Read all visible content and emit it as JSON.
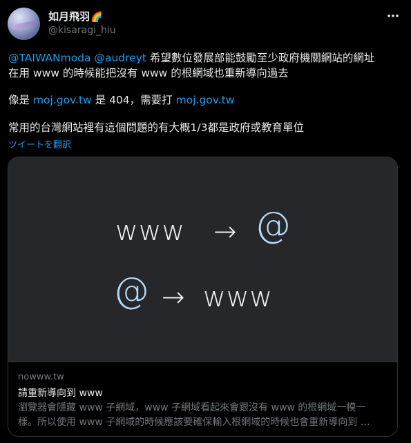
{
  "author": {
    "display_name": "如月飛羽",
    "emoji": "🌈",
    "handle": "@kisaragi_hiu"
  },
  "tweet": {
    "line1": {
      "mention1": "@TAIWANmoda",
      "mention2": "@audreyt",
      "text": " 希望數位發展部能鼓勵至少政府機關網站的網址"
    },
    "line2": "在用 www 的時候能把沒有 www 的根網域也重新導向過去",
    "line3": {
      "prefix": "像是 ",
      "link1": "moj.gov.tw",
      "middle": " 是 404，需要打 ",
      "link2": "moj.gov.tw"
    },
    "line4": "常用的台灣網站裡有這個問題的有大概1/3都是政府或教育單位",
    "translate": "ツイートを翻訳"
  },
  "card": {
    "image": {
      "row1_left": "www",
      "row1_arrow": "→",
      "row1_right": "@",
      "row2_left": "@",
      "row2_arrow": "→",
      "row2_right": "www"
    },
    "domain": "nowww.tw",
    "title": "請重新導向到 www",
    "desc_line1": "瀏覽器會隱藏 www 子網域，www 子網域看起來會跟沒有 www 的根網域一模一",
    "desc_line2": "樣。所以使用 www 子網域的時候應該要確保輸入根網域的時候也會重新導向到 …"
  },
  "colors": {
    "background": "#000000",
    "text": "#e7e9ea",
    "secondary": "#71767b",
    "link": "#1d9bf0",
    "card_image_bg": "#25272b",
    "border": "#2f3336",
    "at_sign": "#b8d8f5"
  },
  "icons": {
    "more": "more-horizontal-icon"
  }
}
